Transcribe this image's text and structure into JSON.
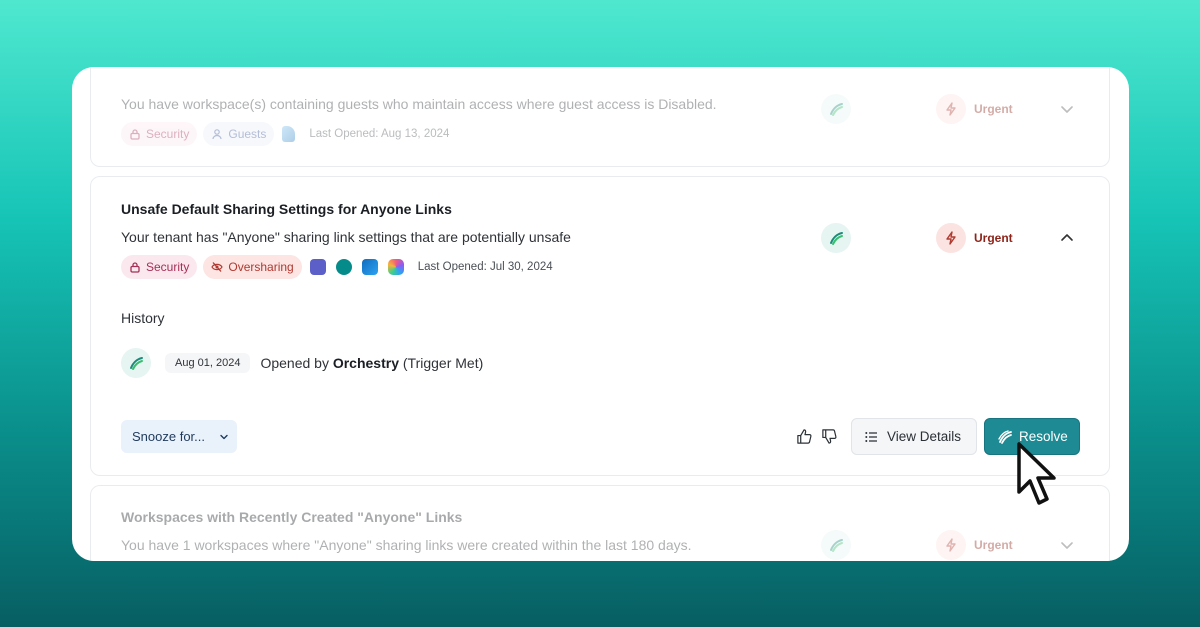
{
  "cards": [
    {
      "description": "You have workspace(s) containing guests who maintain access where guest access is Disabled.",
      "tags": [
        "Security",
        "Guests"
      ],
      "last_opened": "Last Opened: Aug 13, 2024",
      "priority": "Urgent"
    },
    {
      "title": "Unsafe Default Sharing Settings for Anyone Links",
      "description": "Your tenant has \"Anyone\" sharing link settings that are potentially unsafe",
      "tags": [
        "Security",
        "Oversharing"
      ],
      "apps": [
        "teams-icon",
        "sharepoint-icon",
        "onedrive-icon",
        "copilot-icon"
      ],
      "last_opened": "Last Opened: Jul 30, 2024",
      "priority": "Urgent",
      "history_label": "History",
      "history": [
        {
          "date": "Aug 01, 2024",
          "prefix": "Opened by",
          "actor": "Orchestry",
          "suffix": "(Trigger Met)"
        }
      ],
      "snooze_label": "Snooze for...",
      "view_details_label": "View Details",
      "resolve_label": "Resolve"
    },
    {
      "title": "Workspaces with Recently Created \"Anyone\" Links",
      "description": "You have 1 workspaces where \"Anyone\" sharing links were created within the last 180 days.",
      "priority": "Urgent"
    }
  ],
  "colors": {
    "accent": "#1d8a94",
    "urgent_text": "#8e2419",
    "urgent_bg": "#fbe3e1",
    "security_bg": "#fbe8ee",
    "oversharing_bg": "#fce5e3",
    "guests_bg": "#e9edf8"
  }
}
